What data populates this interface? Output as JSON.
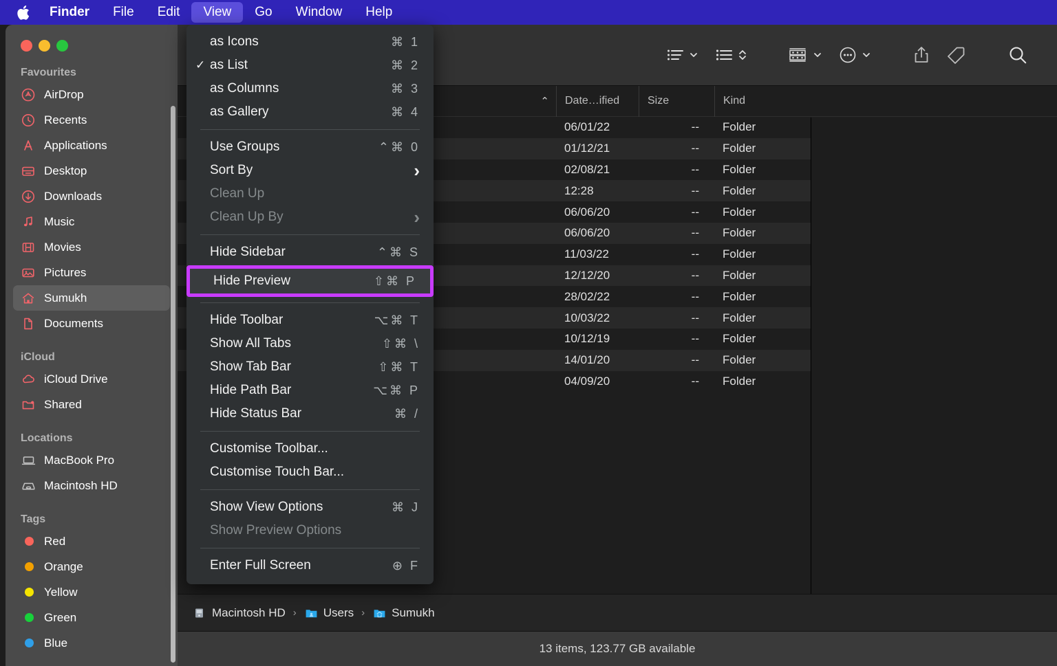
{
  "menubar": {
    "apple_icon": "apple-logo-icon",
    "items": [
      {
        "label": "Finder",
        "bold": true,
        "active": false
      },
      {
        "label": "File",
        "bold": false,
        "active": false
      },
      {
        "label": "Edit",
        "bold": false,
        "active": false
      },
      {
        "label": "View",
        "bold": false,
        "active": true
      },
      {
        "label": "Go",
        "bold": false,
        "active": false
      },
      {
        "label": "Window",
        "bold": false,
        "active": false
      },
      {
        "label": "Help",
        "bold": false,
        "active": false
      }
    ],
    "background_color": "#3024b8",
    "active_color": "#5b4edb"
  },
  "view_menu": {
    "highlight_color": "#c83bff",
    "groups": [
      {
        "items": [
          {
            "label": "as Icons",
            "shortcut": "⌘ 1",
            "checked": false,
            "disabled": false,
            "submenu": false
          },
          {
            "label": "as List",
            "shortcut": "⌘ 2",
            "checked": true,
            "disabled": false,
            "submenu": false
          },
          {
            "label": "as Columns",
            "shortcut": "⌘ 3",
            "checked": false,
            "disabled": false,
            "submenu": false
          },
          {
            "label": "as Gallery",
            "shortcut": "⌘ 4",
            "checked": false,
            "disabled": false,
            "submenu": false
          }
        ]
      },
      {
        "items": [
          {
            "label": "Use Groups",
            "shortcut": "⌃⌘ 0",
            "checked": false,
            "disabled": false,
            "submenu": false
          },
          {
            "label": "Sort By",
            "shortcut": "",
            "checked": false,
            "disabled": false,
            "submenu": true
          },
          {
            "label": "Clean Up",
            "shortcut": "",
            "checked": false,
            "disabled": true,
            "submenu": false
          },
          {
            "label": "Clean Up By",
            "shortcut": "",
            "checked": false,
            "disabled": true,
            "submenu": true
          }
        ]
      },
      {
        "items": [
          {
            "label": "Hide Sidebar",
            "shortcut": "⌃⌘ S",
            "checked": false,
            "disabled": false,
            "submenu": false,
            "highlighted": false
          },
          {
            "label": "Hide Preview",
            "shortcut": "⇧⌘ P",
            "checked": false,
            "disabled": false,
            "submenu": false,
            "highlighted": true
          }
        ]
      },
      {
        "items": [
          {
            "label": "Hide Toolbar",
            "shortcut": "⌥⌘ T",
            "checked": false,
            "disabled": false,
            "submenu": false
          },
          {
            "label": "Show All Tabs",
            "shortcut": "⇧⌘ \\",
            "checked": false,
            "disabled": false,
            "submenu": false
          },
          {
            "label": "Show Tab Bar",
            "shortcut": "⇧⌘ T",
            "checked": false,
            "disabled": false,
            "submenu": false
          },
          {
            "label": "Hide Path Bar",
            "shortcut": "⌥⌘ P",
            "checked": false,
            "disabled": false,
            "submenu": false
          },
          {
            "label": "Hide Status Bar",
            "shortcut": "⌘ /",
            "checked": false,
            "disabled": false,
            "submenu": false
          }
        ]
      },
      {
        "items": [
          {
            "label": "Customise Toolbar...",
            "shortcut": "",
            "checked": false,
            "disabled": false,
            "submenu": false
          },
          {
            "label": "Customise Touch Bar...",
            "shortcut": "",
            "checked": false,
            "disabled": false,
            "submenu": false
          }
        ]
      },
      {
        "items": [
          {
            "label": "Show View Options",
            "shortcut": "⌘ J",
            "checked": false,
            "disabled": false,
            "submenu": false
          },
          {
            "label": "Show Preview Options",
            "shortcut": "",
            "checked": false,
            "disabled": true,
            "submenu": false
          }
        ]
      },
      {
        "items": [
          {
            "label": "Enter Full Screen",
            "shortcut": "⊕ F",
            "checked": false,
            "disabled": false,
            "submenu": false
          }
        ]
      }
    ]
  },
  "window_controls": {
    "close": "#f9655b",
    "minimize": "#f9bd2e",
    "maximize": "#28c73f"
  },
  "sidebar": {
    "sections": [
      {
        "title": "Favourites",
        "items": [
          {
            "label": "AirDrop",
            "icon": "airdrop-icon",
            "color": "#f2646a",
            "selected": false
          },
          {
            "label": "Recents",
            "icon": "clock-icon",
            "color": "#f2646a",
            "selected": false
          },
          {
            "label": "Applications",
            "icon": "app-store-icon",
            "color": "#f2646a",
            "selected": false
          },
          {
            "label": "Desktop",
            "icon": "desktop-icon",
            "color": "#f2646a",
            "selected": false
          },
          {
            "label": "Downloads",
            "icon": "download-icon",
            "color": "#f2646a",
            "selected": false
          },
          {
            "label": "Music",
            "icon": "music-note-icon",
            "color": "#f2646a",
            "selected": false
          },
          {
            "label": "Movies",
            "icon": "film-icon",
            "color": "#f2646a",
            "selected": false
          },
          {
            "label": "Pictures",
            "icon": "photo-icon",
            "color": "#f2646a",
            "selected": false
          },
          {
            "label": "Sumukh",
            "icon": "home-icon",
            "color": "#f2646a",
            "selected": true
          },
          {
            "label": "Documents",
            "icon": "document-icon",
            "color": "#f2646a",
            "selected": false
          }
        ]
      },
      {
        "title": "iCloud",
        "items": [
          {
            "label": "iCloud Drive",
            "icon": "cloud-icon",
            "color": "#f2646a",
            "selected": false
          },
          {
            "label": "Shared",
            "icon": "shared-folder-icon",
            "color": "#f2646a",
            "selected": false
          }
        ]
      },
      {
        "title": "Locations",
        "items": [
          {
            "label": "MacBook Pro",
            "icon": "laptop-icon",
            "color": "#c4c4c4",
            "selected": false
          },
          {
            "label": "Macintosh HD",
            "icon": "harddisk-icon",
            "color": "#c4c4c4",
            "selected": false
          }
        ]
      },
      {
        "title": "Tags",
        "items": [
          {
            "label": "Red",
            "icon": "tag-dot-icon",
            "color": "#f9655b",
            "selected": false
          },
          {
            "label": "Orange",
            "icon": "tag-dot-icon",
            "color": "#f2a000",
            "selected": false
          },
          {
            "label": "Yellow",
            "icon": "tag-dot-icon",
            "color": "#f5e400",
            "selected": false
          },
          {
            "label": "Green",
            "icon": "tag-dot-icon",
            "color": "#18d13b",
            "selected": false
          },
          {
            "label": "Blue",
            "icon": "tag-dot-icon",
            "color": "#2f9fe8",
            "selected": false
          }
        ]
      }
    ]
  },
  "toolbar": {
    "buttons": [
      {
        "name": "view-as-list-button",
        "icon": "list-view-icon",
        "chevron": true
      },
      {
        "name": "group-by-button",
        "icon": "sort-list-icon",
        "chevron": false,
        "updown": true
      },
      {
        "name": "arrange-items-button",
        "icon": "grid-group-icon",
        "chevron": true
      },
      {
        "name": "action-menu-button",
        "icon": "ellipsis-circle-icon",
        "chevron": true
      },
      {
        "name": "share-button",
        "icon": "share-icon",
        "chevron": false
      },
      {
        "name": "tags-button",
        "icon": "tag-icon",
        "chevron": false
      },
      {
        "name": "search-button",
        "icon": "search-icon",
        "chevron": false
      }
    ]
  },
  "filelist": {
    "columns": [
      {
        "key": "name",
        "label": "",
        "sort_indicator": "⌃"
      },
      {
        "key": "date",
        "label": "Date…ified"
      },
      {
        "key": "size",
        "label": "Size"
      },
      {
        "key": "kind",
        "label": "Kind"
      }
    ],
    "rows": [
      {
        "name": "",
        "date": "06/01/22",
        "size": "--",
        "kind": "Folder"
      },
      {
        "name": "",
        "date": "01/12/21",
        "size": "--",
        "kind": "Folder"
      },
      {
        "name": "",
        "date": "02/08/21",
        "size": "--",
        "kind": "Folder"
      },
      {
        "name": "",
        "date": "12:28",
        "size": "--",
        "kind": "Folder"
      },
      {
        "name": "",
        "date": "06/06/20",
        "size": "--",
        "kind": "Folder"
      },
      {
        "name": "",
        "date": "06/06/20",
        "size": "--",
        "kind": "Folder"
      },
      {
        "name": "",
        "date": "11/03/22",
        "size": "--",
        "kind": "Folder"
      },
      {
        "name": "",
        "date": "12/12/20",
        "size": "--",
        "kind": "Folder"
      },
      {
        "name": "",
        "date": "28/02/22",
        "size": "--",
        "kind": "Folder"
      },
      {
        "name": "",
        "date": "10/03/22",
        "size": "--",
        "kind": "Folder"
      },
      {
        "name": "",
        "date": "10/12/19",
        "size": "--",
        "kind": "Folder"
      },
      {
        "name": "",
        "date": "14/01/20",
        "size": "--",
        "kind": "Folder"
      },
      {
        "name": "",
        "date": "04/09/20",
        "size": "--",
        "kind": "Folder"
      }
    ]
  },
  "pathbar": {
    "segments": [
      {
        "label": "Macintosh HD",
        "icon": "harddisk-icon"
      },
      {
        "label": "Users",
        "icon": "folder-icon"
      },
      {
        "label": "Sumukh",
        "icon": "home-folder-icon"
      }
    ],
    "separator": "›"
  },
  "statusbar": {
    "text": "13 items, 123.77 GB available"
  }
}
